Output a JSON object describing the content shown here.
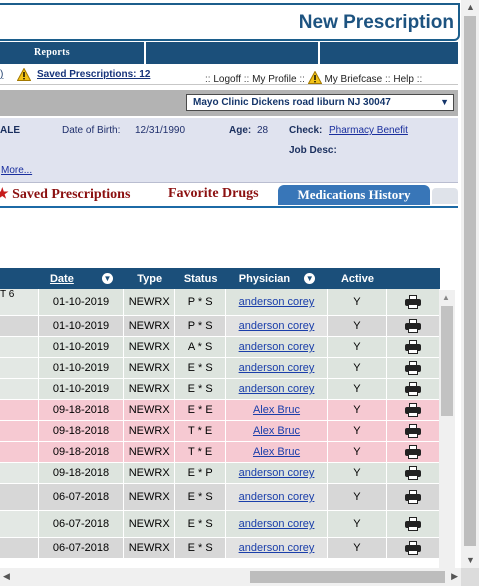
{
  "header": {
    "title": "New Prescription"
  },
  "nav": {
    "reports_label": "Reports"
  },
  "toolbar": {
    "fragment": ")",
    "saved_prescriptions": "Saved Prescriptions: 12",
    "links_prefix": "::",
    "logoff": "Logoff",
    "my_profile": "My Profile",
    "my_briefcase": "My Briefcase",
    "help": "Help",
    "sep": "::"
  },
  "location": {
    "selected": "Mayo Clinic Dickens road liburn NJ 30047",
    "arrow": "▼"
  },
  "patient": {
    "ale": "ALE",
    "dob_label": "Date of Birth:",
    "dob_value": "12/31/1990",
    "age_label": "Age:",
    "age_value": "28",
    "check_label": "Check:",
    "check_link": "Pharmacy Benefit",
    "jobdesc_label": "Job Desc:",
    "more_link": "More..."
  },
  "tabs": {
    "saved_star": "★",
    "saved": "Saved Prescriptions",
    "favorite": "Favorite Drugs",
    "history": "Medications History"
  },
  "table": {
    "headers": {
      "date": "Date",
      "type": "Type",
      "status": "Status",
      "physician": "Physician",
      "active": "Active"
    },
    "first_fragment": "T 6",
    "rows": [
      {
        "date": "01-10-2019",
        "type": "NEWRX",
        "status": "P * S",
        "physician": "anderson corey",
        "active": "Y"
      },
      {
        "date": "01-10-2019",
        "type": "NEWRX",
        "status": "P * S",
        "physician": "anderson corey",
        "active": "Y"
      },
      {
        "date": "01-10-2019",
        "type": "NEWRX",
        "status": "A * S",
        "physician": "anderson corey",
        "active": "Y"
      },
      {
        "date": "01-10-2019",
        "type": "NEWRX",
        "status": "E * S",
        "physician": "anderson corey",
        "active": "Y"
      },
      {
        "date": "01-10-2019",
        "type": "NEWRX",
        "status": "E * S",
        "physician": "anderson corey",
        "active": "Y"
      },
      {
        "date": "09-18-2018",
        "type": "NEWRX",
        "status": "E * E",
        "physician": "Alex Bruc",
        "active": "Y"
      },
      {
        "date": "09-18-2018",
        "type": "NEWRX",
        "status": "T * E",
        "physician": "Alex Bruc",
        "active": "Y"
      },
      {
        "date": "09-18-2018",
        "type": "NEWRX",
        "status": "T * E",
        "physician": "Alex Bruc",
        "active": "Y"
      },
      {
        "date": "09-18-2018",
        "type": "NEWRX",
        "status": "E * P",
        "physician": "anderson corey",
        "active": "Y"
      },
      {
        "date": "06-07-2018",
        "type": "NEWRX",
        "status": "E * S",
        "physician": "anderson corey",
        "active": "Y"
      },
      {
        "date": "06-07-2018",
        "type": "NEWRX",
        "status": "E * S",
        "physician": "anderson corey",
        "active": "Y"
      },
      {
        "date": "06-07-2018",
        "type": "NEWRX",
        "status": "E * S",
        "physician": "anderson corey",
        "active": "Y"
      }
    ]
  },
  "colors": {
    "nav_blue": "#1b4f7a",
    "tab_active": "#3876b8",
    "row_pink": "#f6c9d2",
    "row_green": "#e3e8e4",
    "link": "#1a3eaa"
  },
  "icons": {
    "warning": "warning-icon",
    "sort": "sort-icon",
    "print": "printer-icon"
  }
}
